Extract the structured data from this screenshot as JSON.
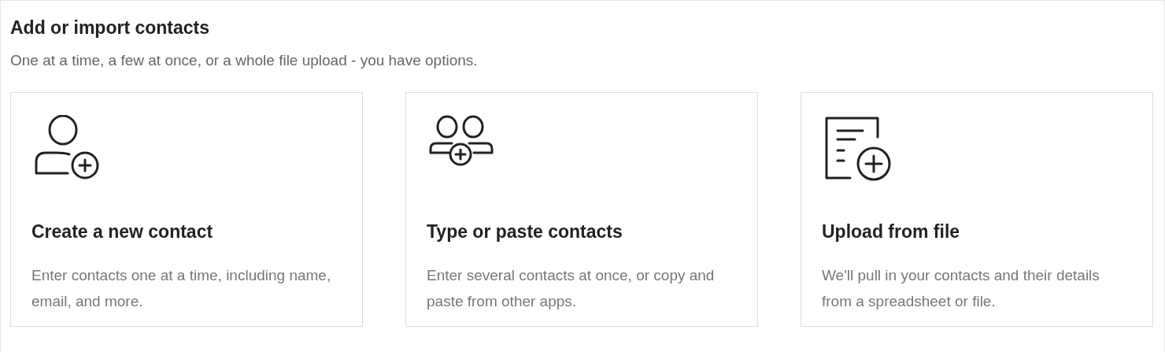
{
  "title": "Add or import contacts",
  "subtitle": "One at a time, a few at once, or a whole file upload - you have options.",
  "cards": [
    {
      "kind": "person",
      "title": "Create a new contact",
      "description": "Enter contacts one at a time, including name, email, and more."
    },
    {
      "kind": "people",
      "title": "Type or paste contacts",
      "description": "Enter several contacts at once, or copy and paste from other apps."
    },
    {
      "kind": "file",
      "title": "Upload from file",
      "description": "We'll pull in your contacts and their details from a spreadsheet or file."
    }
  ]
}
